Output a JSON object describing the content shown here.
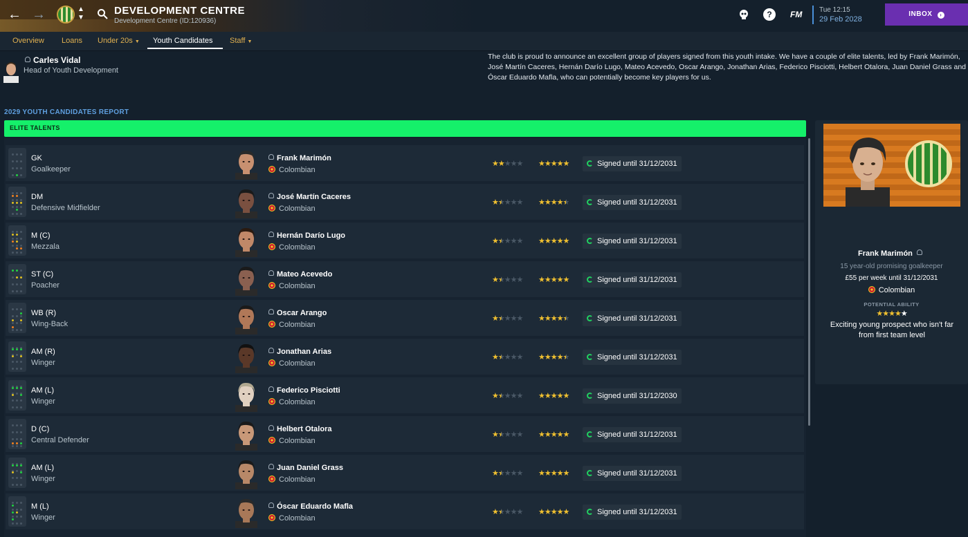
{
  "header": {
    "title": "DEVELOPMENT CENTRE",
    "subtitle": "Development Centre (ID:120936)",
    "back_icon": "arrow-left-icon",
    "forward_icon": "arrow-right-icon",
    "time": "Tue 12:15",
    "date": "29 Feb 2028",
    "fm_label": "FM",
    "help_label": "?",
    "inbox_label": "INBOX"
  },
  "tabs": [
    {
      "label": "Overview"
    },
    {
      "label": "Loans"
    },
    {
      "label": "Under 20s"
    },
    {
      "label": "Youth Candidates"
    },
    {
      "label": "Staff"
    }
  ],
  "head_of_youth": {
    "name": "Carles Vidal",
    "role": "Head of Youth Development"
  },
  "report_text": "The club is proud to announce an excellent group of players signed from this youth intake. We have a couple of elite talents, led by Frank Marimón, José Martín Caceres, Hernán Darío Lugo, Mateo Acevedo, Oscar Arango, Jonathan Arias, Federico Pisciotti, Helbert Otalora, Juan Daniel Grass and Óscar Eduardo Mafla, who can potentially become key players for us.",
  "report_title": "2029 YOUTH CANDIDATES REPORT",
  "section_label": "ELITE TALENTS",
  "players": [
    {
      "pos_code": "GK",
      "pos_name": "Goalkeeper",
      "name": "Frank Marimón",
      "nationality": "Colombian",
      "current_ability_stars": 2,
      "potential_ability_stars": 5,
      "contract": "Signed until 31/12/2031"
    },
    {
      "pos_code": "DM",
      "pos_name": "Defensive Midfielder",
      "name": "José Martín Caceres",
      "nationality": "Colombian",
      "current_ability_stars": 1.5,
      "potential_ability_stars": 4.5,
      "contract": "Signed until 31/12/2031"
    },
    {
      "pos_code": "M (C)",
      "pos_name": "Mezzala",
      "name": "Hernán Darío Lugo",
      "nationality": "Colombian",
      "current_ability_stars": 1.5,
      "potential_ability_stars": 5,
      "contract": "Signed until 31/12/2031"
    },
    {
      "pos_code": "ST (C)",
      "pos_name": "Poacher",
      "name": "Mateo Acevedo",
      "nationality": "Colombian",
      "current_ability_stars": 1.5,
      "potential_ability_stars": 5,
      "contract": "Signed until 31/12/2031"
    },
    {
      "pos_code": "WB (R)",
      "pos_name": "Wing-Back",
      "name": "Oscar Arango",
      "nationality": "Colombian",
      "current_ability_stars": 1.5,
      "potential_ability_stars": 4.5,
      "contract": "Signed until 31/12/2031"
    },
    {
      "pos_code": "AM (R)",
      "pos_name": "Winger",
      "name": "Jonathan Arias",
      "nationality": "Colombian",
      "current_ability_stars": 1.5,
      "potential_ability_stars": 4.5,
      "contract": "Signed until 31/12/2031"
    },
    {
      "pos_code": "AM (L)",
      "pos_name": "Winger",
      "name": "Federico Pisciotti",
      "nationality": "Colombian",
      "current_ability_stars": 1.5,
      "potential_ability_stars": 5,
      "contract": "Signed until 31/12/2030"
    },
    {
      "pos_code": "D (C)",
      "pos_name": "Central Defender",
      "name": "Helbert Otalora",
      "nationality": "Colombian",
      "current_ability_stars": 1.5,
      "potential_ability_stars": 5,
      "contract": "Signed until 31/12/2031"
    },
    {
      "pos_code": "AM (L)",
      "pos_name": "Winger",
      "name": "Juan Daniel Grass",
      "nationality": "Colombian",
      "current_ability_stars": 1.5,
      "potential_ability_stars": 5,
      "contract": "Signed until 31/12/2031"
    },
    {
      "pos_code": "M (L)",
      "pos_name": "Winger",
      "name": "Óscar Eduardo Mafla",
      "nationality": "Colombian",
      "current_ability_stars": 1.5,
      "potential_ability_stars": 5,
      "contract": "Signed until 31/12/2031"
    }
  ],
  "side_panel": {
    "name": "Frank Marimón",
    "description_line": "15 year-old promising goalkeeper",
    "wage_line": "£55 per week until 31/12/2031",
    "nationality": "Colombian",
    "pa_label": "POTENTIAL ABILITY",
    "pa_stars": 4,
    "summary": "Exciting young prospect who isn't far from first team level"
  },
  "colors": {
    "accent_green": "#15f06a",
    "inbox_purple": "#6a2fb0",
    "tab_gold": "#e0b050",
    "star_gold": "#f0c030"
  }
}
